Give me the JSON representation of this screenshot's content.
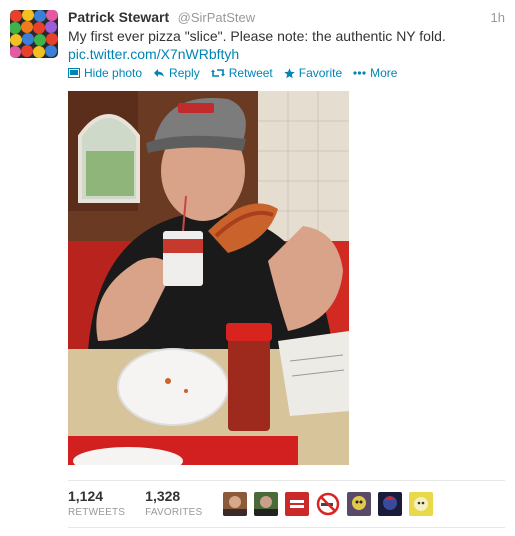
{
  "tweet": {
    "fullname": "Patrick Stewart",
    "username": "@SirPatStew",
    "timestamp": "1h",
    "text": "My first ever pizza \"slice\". Please note: the authentic NY fold.",
    "link": "pic.twitter.com/X7nWRbftyh"
  },
  "actions": {
    "hide_photo": "Hide photo",
    "reply": "Reply",
    "retweet": "Retweet",
    "favorite": "Favorite",
    "more": "More"
  },
  "stats": {
    "retweets_count": "1,124",
    "retweets_label": "RETWEETS",
    "favorites_count": "1,328",
    "favorites_label": "FAVORITES"
  },
  "favoriters": [
    {
      "icon": "user-avatar-1-icon"
    },
    {
      "icon": "user-avatar-2-icon"
    },
    {
      "icon": "equality-logo-icon"
    },
    {
      "icon": "no-smoking-icon"
    },
    {
      "icon": "user-avatar-5-icon"
    },
    {
      "icon": "user-avatar-6-icon"
    },
    {
      "icon": "user-avatar-7-icon"
    }
  ],
  "colors": {
    "link": "#0084b4",
    "muted": "#999999",
    "text": "#333333"
  }
}
